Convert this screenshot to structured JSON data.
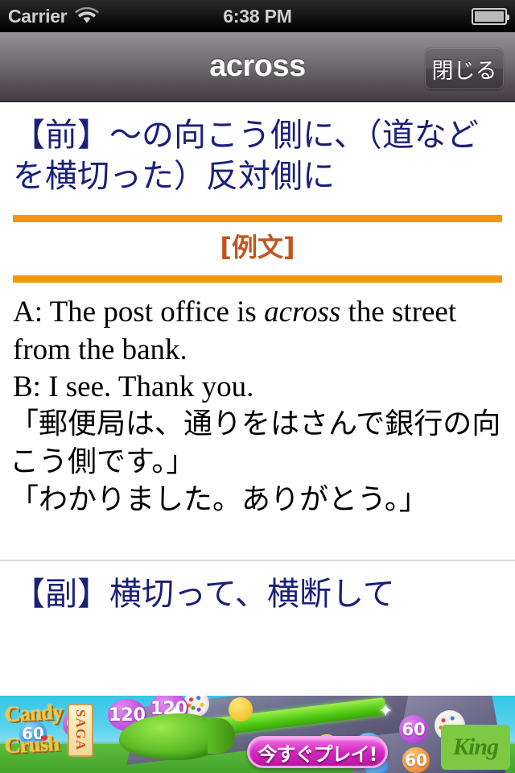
{
  "status_bar": {
    "carrier": "Carrier",
    "time": "6:38 PM",
    "wifi_icon": "wifi-icon",
    "battery_icon": "battery-icon"
  },
  "nav_bar": {
    "title": "across",
    "close_label": "閉じる"
  },
  "content": {
    "definition": "【前】〜の向こう側に、（道などを横切った）反対側に",
    "example_label": "[例文]",
    "example_en_line1_a": "A: The post office is ",
    "example_en_italic": "across",
    "example_en_line1_b": " the street from the bank.",
    "example_en_line2": "B: I see. Thank you.",
    "example_ja_line1": "「郵便局は、通りをはさんで銀行の向こう側です。」",
    "example_ja_line2": "「わかりました。ありがとう。」",
    "next_definition": "【副】横切って、横断して"
  },
  "ad": {
    "brand_line1": "Candy",
    "brand_line2": "Crush",
    "tag": "SAGA",
    "cta_label": "今すぐプレイ!",
    "publisher": "King",
    "scores": [
      "60",
      "60",
      "120",
      "120",
      "60",
      "60"
    ]
  },
  "colors": {
    "definition_text": "#1a1f7a",
    "rule_orange": "#f59511",
    "example_label": "#c1551f",
    "nav_bar_top": "#949196",
    "nav_bar_bottom": "#453e44",
    "cta_pink": "#d428c0"
  }
}
